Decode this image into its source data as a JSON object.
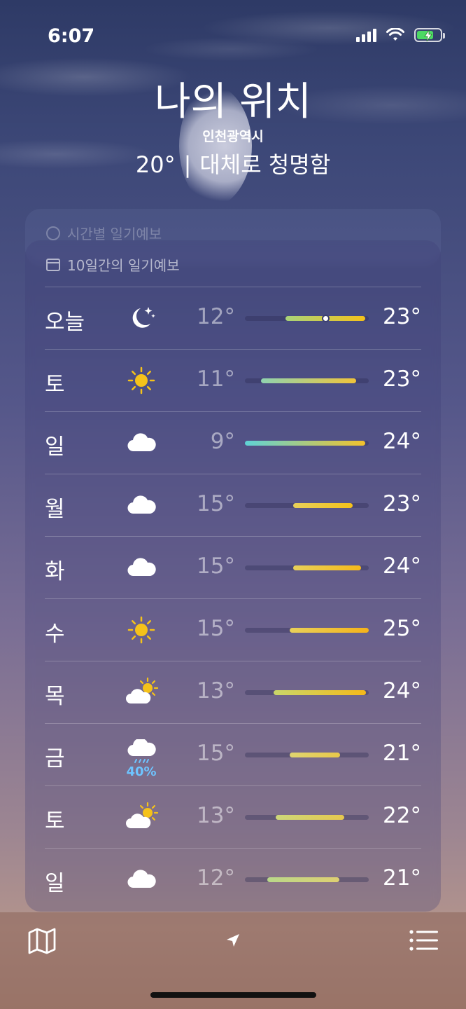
{
  "status": {
    "time": "6:07"
  },
  "header": {
    "location": "나의 위치",
    "sublocation": "인천광역시",
    "temp": "20°",
    "separator": "|",
    "condition": "대체로 청명함"
  },
  "hourly": {
    "label": "시간별 일기예보"
  },
  "forecast": {
    "label": "10일간의 일기예보",
    "days": [
      {
        "day": "오늘",
        "icon": "moon-stars-icon",
        "low": "12°",
        "high": "23°",
        "bar_from": 0.33,
        "bar_to": 0.97,
        "current": 0.65,
        "colors": [
          "#a8d37a",
          "#f5c21a"
        ]
      },
      {
        "day": "토",
        "icon": "sun-icon",
        "low": "11°",
        "high": "23°",
        "bar_from": 0.13,
        "bar_to": 0.9,
        "colors": [
          "#8fd3b0",
          "#f0c43a"
        ]
      },
      {
        "day": "일",
        "icon": "cloud-icon",
        "low": "9°",
        "high": "24°",
        "bar_from": 0.0,
        "bar_to": 0.97,
        "colors": [
          "#5fd2d6",
          "#f3c22c"
        ]
      },
      {
        "day": "월",
        "icon": "cloud-icon",
        "low": "15°",
        "high": "23°",
        "bar_from": 0.39,
        "bar_to": 0.87,
        "colors": [
          "#e8d05a",
          "#f5c21a"
        ]
      },
      {
        "day": "화",
        "icon": "cloud-icon",
        "low": "15°",
        "high": "24°",
        "bar_from": 0.39,
        "bar_to": 0.94,
        "colors": [
          "#e8d05a",
          "#f5b91a"
        ]
      },
      {
        "day": "수",
        "icon": "sun-icon",
        "low": "15°",
        "high": "25°",
        "bar_from": 0.36,
        "bar_to": 1.0,
        "colors": [
          "#e8d05a",
          "#f5b31a"
        ]
      },
      {
        "day": "목",
        "icon": "partly-cloudy-icon",
        "low": "13°",
        "high": "24°",
        "bar_from": 0.23,
        "bar_to": 0.98,
        "colors": [
          "#c9d76a",
          "#f5b91a"
        ]
      },
      {
        "day": "금",
        "icon": "rain-cloud-icon",
        "pct": "40%",
        "low": "15°",
        "high": "21°",
        "bar_from": 0.36,
        "bar_to": 0.77,
        "colors": [
          "#e0d570",
          "#e8c84a"
        ]
      },
      {
        "day": "토",
        "icon": "partly-cloudy-icon",
        "low": "13°",
        "high": "22°",
        "bar_from": 0.25,
        "bar_to": 0.8,
        "colors": [
          "#cdd77a",
          "#e6c84e"
        ]
      },
      {
        "day": "일",
        "icon": "cloud-icon",
        "low": "12°",
        "high": "21°",
        "bar_from": 0.18,
        "bar_to": 0.76,
        "colors": [
          "#b9d88a",
          "#dfd072"
        ]
      }
    ]
  }
}
